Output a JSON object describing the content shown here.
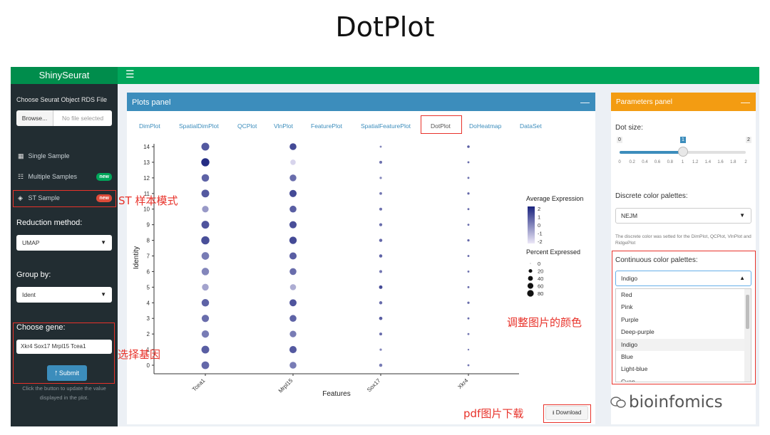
{
  "slide_title": "DotPlot",
  "app": {
    "brand": "ShinySeurat",
    "hamburger_icon": "hamburger-icon"
  },
  "sidebar": {
    "file_label": "Choose Seurat Object RDS File",
    "browse_button": "Browse...",
    "file_status": "No file selected",
    "menu": [
      {
        "label": "Single Sample",
        "icon": "grid-icon",
        "badge": ""
      },
      {
        "label": "Multiple Samples",
        "icon": "sitemap-icon",
        "badge": "new"
      },
      {
        "label": "ST Sample",
        "icon": "layers-icon",
        "badge": "new"
      }
    ],
    "reduction_label": "Reduction method:",
    "reduction_value": "UMAP",
    "group_label": "Group by:",
    "group_value": "Ident",
    "gene_label": "Choose gene:",
    "genes": "Xkr4 Sox17 Mrpl15 Tcea1",
    "submit_button": "Submit",
    "help_line1": "Click the button to update the value",
    "help_line2": "displayed in the plot."
  },
  "plots_panel": {
    "title": "Plots panel",
    "tabs": [
      "DimPlot",
      "SpatialDimPlot",
      "QCPlot",
      "VlnPlot",
      "FeaturePlot",
      "SpatialFeaturePlot",
      "DotPlot",
      "DoHeatmap",
      "DataSet"
    ],
    "active_tab": "DotPlot",
    "download_button": "Download"
  },
  "params_panel": {
    "title": "Parameters panel",
    "dot_size_label": "Dot size:",
    "slider": {
      "min": 0,
      "max": 2,
      "value": 1,
      "ticks": [
        "0",
        "0.2",
        "0.4",
        "0.6",
        "0.8",
        "1",
        "1.2",
        "1.4",
        "1.6",
        "1.8",
        "2"
      ]
    },
    "discrete_label": "Discrete color palettes:",
    "discrete_value": "NEJM",
    "discrete_help": "The discrete color was setted for the DimPlot, QCPlot, VlnPlot and RidgePlot",
    "continuous_label": "Continuous color palettes:",
    "continuous_value": "Indigo",
    "options": [
      "Red",
      "Pink",
      "Purple",
      "Deep-purple",
      "Indigo",
      "Blue",
      "Light-blue",
      "Cyan"
    ],
    "highlighted_option": "Indigo"
  },
  "annotations": {
    "st_mode": "ST 样本模式",
    "select_gene": "选择基因",
    "adjust_color": "调整图片的颜色",
    "pdf_download": "pdf图片下载"
  },
  "watermark": "bioinfomics",
  "chart_data": {
    "type": "scatter",
    "xlabel": "Features",
    "ylabel": "Identity",
    "x_categories": [
      "Tcea1",
      "Mrpl15",
      "Sox17",
      "Xkr4"
    ],
    "y_categories": [
      "0",
      "1",
      "2",
      "3",
      "4",
      "5",
      "6",
      "7",
      "8",
      "9",
      "10",
      "11",
      "12",
      "13",
      "14"
    ],
    "legend_color_title": "Average Expression",
    "legend_color_ticks": [
      "2",
      "1",
      "0",
      "-1",
      "-2"
    ],
    "legend_size_title": "Percent Expressed",
    "legend_size_ticks": [
      "0",
      "20",
      "40",
      "60",
      "80"
    ],
    "color_range": [
      -2,
      2
    ],
    "colors": {
      "low": "#ece8f8",
      "high": "#1a237e"
    },
    "points": {
      "Tcea1": {
        "pct": [
          68,
          70,
          62,
          60,
          64,
          50,
          64,
          66,
          78,
          70,
          48,
          70,
          64,
          78,
          72
        ],
        "avg": [
          0.6,
          0.8,
          0.2,
          0.5,
          0.7,
          -0.6,
          0.0,
          0.2,
          1.1,
          1.0,
          -0.4,
          0.9,
          0.7,
          1.8,
          0.9
        ]
      },
      "Mrpl15": {
        "pct": [
          52,
          58,
          48,
          52,
          56,
          40,
          52,
          58,
          62,
          58,
          52,
          58,
          50,
          30,
          52
        ],
        "avg": [
          0.2,
          0.9,
          0.2,
          0.7,
          1.0,
          -0.8,
          0.5,
          0.8,
          1.2,
          1.1,
          0.8,
          1.2,
          0.5,
          -1.6,
          1.2
        ]
      },
      "Sox17": {
        "pct": [
          8,
          3,
          6,
          9,
          8,
          10,
          6,
          8,
          8,
          7,
          6,
          5,
          3,
          6,
          2
        ],
        "avg": [
          0.2,
          0,
          0.5,
          0.8,
          0.5,
          1.2,
          0.3,
          0.7,
          0.6,
          0.5,
          0.4,
          0.3,
          0,
          0.4,
          0
        ]
      },
      "Xkr4": {
        "pct": [
          2,
          1,
          2,
          2,
          3,
          2,
          2,
          2,
          3,
          2,
          2,
          3,
          2,
          2,
          4
        ],
        "avg": [
          0.3,
          0.2,
          0.3,
          0.5,
          0.5,
          0.5,
          0.4,
          0.6,
          0.6,
          0.5,
          0.5,
          0.6,
          0.4,
          0.5,
          0.8
        ]
      }
    }
  }
}
